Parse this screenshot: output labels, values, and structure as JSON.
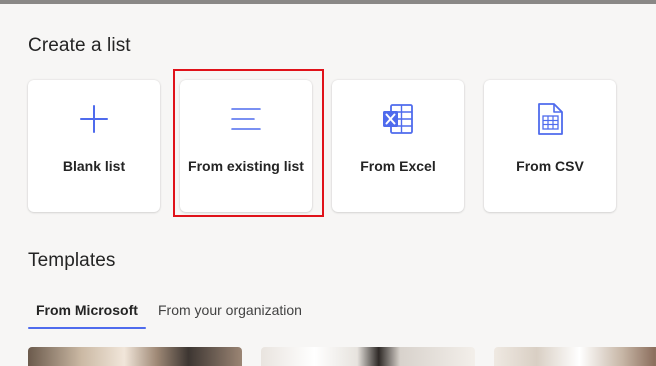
{
  "top_bar": {
    "color": "#8a8886"
  },
  "create_section": {
    "title": "Create a list",
    "cards": [
      {
        "label": "Blank list",
        "icon": "plus-icon"
      },
      {
        "label": "From existing list",
        "icon": "lines-list-icon"
      },
      {
        "label": "From Excel",
        "icon": "excel-icon"
      },
      {
        "label": "From CSV",
        "icon": "csv-file-icon"
      }
    ],
    "selected_card": "From existing list",
    "highlight_color": "#e0121a",
    "icon_color": "#4f6bed"
  },
  "templates_section": {
    "title": "Templates",
    "tabs": [
      {
        "label": "From Microsoft",
        "active": true
      },
      {
        "label": "From your organization",
        "active": false
      }
    ],
    "tab_underline_color": "#4f6bed",
    "thumbnails": [
      {
        "name": "template-thumbnail-1"
      },
      {
        "name": "template-thumbnail-2"
      },
      {
        "name": "template-thumbnail-3"
      }
    ]
  }
}
